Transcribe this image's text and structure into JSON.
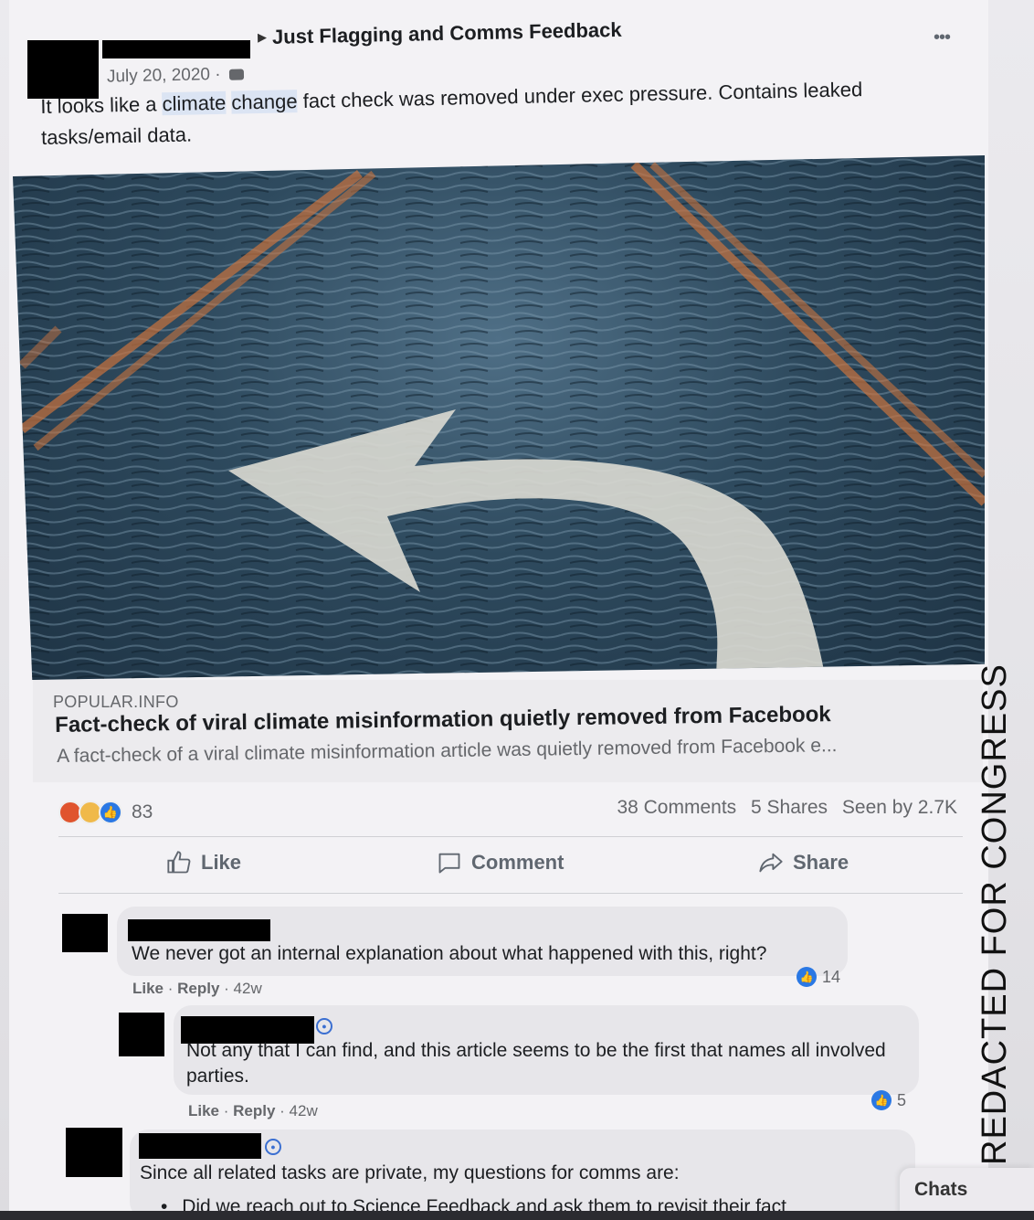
{
  "post": {
    "group_name": "Just Flagging and Comms Feedback",
    "date": "July 20, 2020 ·",
    "privacy_icon": "group-privacy-icon",
    "text_pre": "It looks like a ",
    "text_hl1": "climate",
    "text_hl2": "change",
    "text_post": " fact check was removed under exec pressure. Contains leaked tasks/email data.",
    "more_icon": "•••"
  },
  "link": {
    "domain": "POPULAR.INFO",
    "title": "Fact-check of viral climate misinformation quietly removed from Facebook",
    "description": "A fact-check of a viral climate misinformation article was quietly removed from Facebook e..."
  },
  "stats": {
    "reaction_count": "83",
    "comments": "38 Comments",
    "shares": "5 Shares",
    "seen_by": "Seen by 2.7K"
  },
  "actions": {
    "like": "Like",
    "comment": "Comment",
    "share": "Share"
  },
  "comments": [
    {
      "text": "We never got an internal explanation about what happened with this, right?",
      "like": "Like",
      "reply": "Reply",
      "age": "42w",
      "reactions": "14"
    },
    {
      "text": "Not any that I can find, and this article seems to be the first that names all involved parties.",
      "like": "Like",
      "reply": "Reply",
      "age": "42w",
      "reactions": "5"
    },
    {
      "text": "Since all related tasks are private, my questions for comms are:",
      "bullet": "Did we reach out to Science Feedback and ask them to revisit their fact"
    }
  ],
  "side_label": "REDACTED FOR CONGRESS",
  "chats": "Chats",
  "colors": {
    "accent": "#2a78e4",
    "highlight": "#dbe4f3",
    "text_muted": "#65676b"
  }
}
